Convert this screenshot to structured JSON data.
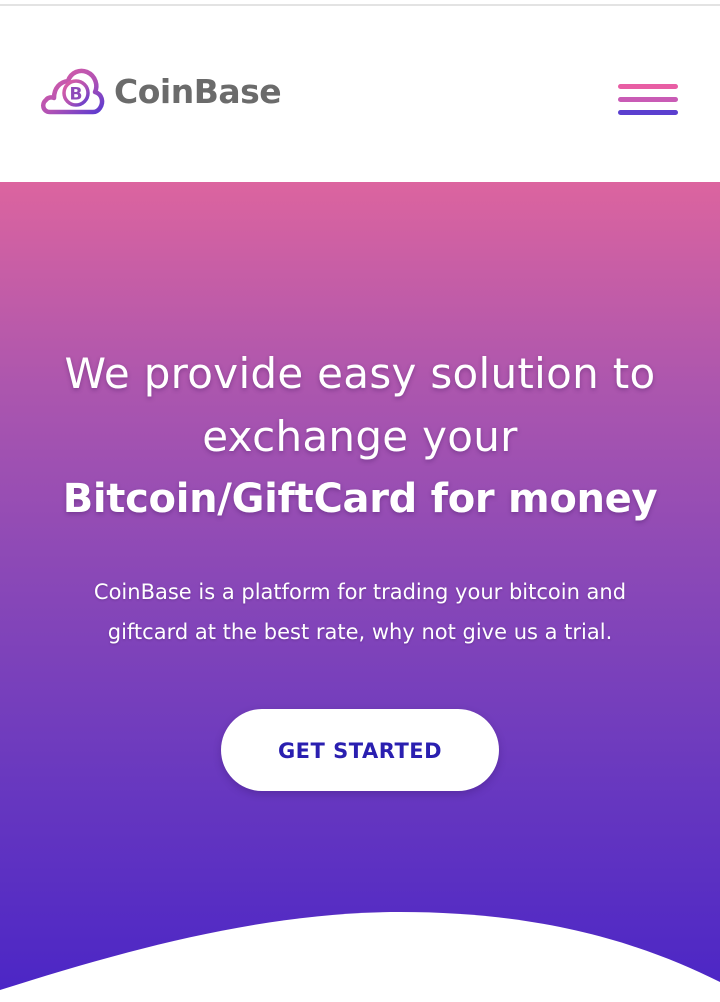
{
  "header": {
    "brand_name": "CoinBase",
    "logo_icon": "cloud-bitcoin-icon",
    "logo_glyph": "B",
    "menu_icon": "hamburger-menu-icon"
  },
  "hero": {
    "headline_line1": "We provide easy solution to",
    "headline_line2": "exchange your",
    "headline_emphasis": "Bitcoin/GiftCard for money",
    "subtext_line1": "CoinBase is a platform for trading your bitcoin and",
    "subtext_line2": "giftcard at the best rate, why not give us a trial.",
    "cta_label": "GET STARTED"
  },
  "colors": {
    "gradient_top": "#dc649f",
    "gradient_bottom": "#4a25c6",
    "cta_text": "#2a1fb0",
    "brand_text": "#6b6b6b",
    "menu_line_1": "#e85ea4",
    "menu_line_2": "#c95bb5",
    "menu_line_3": "#5b3fcf"
  }
}
